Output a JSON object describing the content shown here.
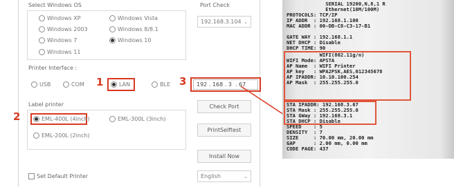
{
  "os_section": {
    "label": "Select Windows OS",
    "options": [
      {
        "label": "Windows XP",
        "selected": false
      },
      {
        "label": "Windows Vista",
        "selected": false
      },
      {
        "label": "Windows 2003",
        "selected": false
      },
      {
        "label": "Windows 8/8.1",
        "selected": false
      },
      {
        "label": "Windows 7",
        "selected": false
      },
      {
        "label": "Windows 10",
        "selected": true
      },
      {
        "label": "Windows 11",
        "selected": false
      }
    ]
  },
  "port_check": {
    "label": "Port Check",
    "selected": "192.168.3.104"
  },
  "printer_interface": {
    "label": "Printer Interface :",
    "options": [
      {
        "label": "USB",
        "selected": false
      },
      {
        "label": "COM",
        "selected": false
      },
      {
        "label": "LAN",
        "selected": true
      },
      {
        "label": "BLE",
        "selected": false
      }
    ],
    "ip_value": "192 . 168 . 3  . 67"
  },
  "label_printer": {
    "label": "Label printer",
    "options": [
      {
        "label": "EML-400L (4inch)",
        "selected": true
      },
      {
        "label": "EML-300L (3inch)",
        "selected": false
      },
      {
        "label": "EML-200L (2inch)",
        "selected": false
      }
    ]
  },
  "buttons": {
    "check_port": "Check Port",
    "print_selftest": "PrintSelftest",
    "install_now": "Install Now"
  },
  "default_printer_label": "Set Default Printer",
  "language": "English",
  "steps": {
    "one": "1",
    "two": "2",
    "three": "3"
  },
  "receipt_lines": [
    "             SERIAL 19200,N,8,1 R",
    "             Ethernet(10M/100M)",
    "PROTOCOLS: TCP/IP",
    "IP ADDR  : 192.168.1.100",
    "MAC ADDR : 00-DB-C8-C3-17-B1",
    "",
    "GATE WAY : 192.168.1.1",
    "NET DHCP : Disable",
    "DHCP TIME: 90",
    "           WIFI(802.11g/n)",
    "WIFI Mode: APSTA",
    "AP Name  : WIFI Printer",
    "AP key   : WPA2PSK,AES,012345678",
    "AP IPADDR: 10.10.100.254",
    "AP Mask  : 255.255.255.0",
    "",
    "STA IPADDR: 192.168.3.67",
    "STA Mask : 255.255.255.0",
    "STA GWay : 192.168.3.1",
    "STA DHCP : Disable",
    "SPEED    : 5",
    "DENSITY  : 7",
    "SIZE     : 70.00 mm, 20.00 mm",
    "GAP      : 2.00 mm, 0.00 mm",
    "CODE PAGE: 437"
  ],
  "colors": {
    "highlight": "#d8381f"
  }
}
